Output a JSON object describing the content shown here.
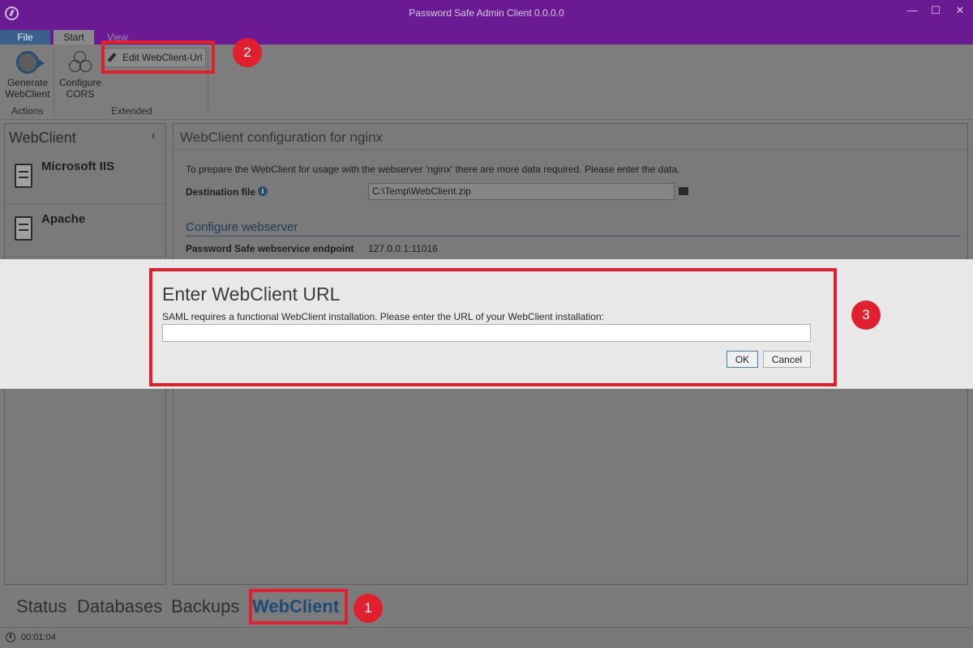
{
  "window": {
    "title": "Password Safe Admin Client 0.0.0.0",
    "controls": {
      "minimize": "—",
      "maximize": "☐",
      "close": "✕"
    }
  },
  "ribbon": {
    "tabs": [
      {
        "label": "File"
      },
      {
        "label": "Start"
      },
      {
        "label": "View"
      }
    ],
    "actions_group": {
      "label": "Actions",
      "buttons": [
        {
          "label": "Generate WebClient",
          "icon": "generate-icon"
        }
      ]
    },
    "extended_group": {
      "label": "Extended",
      "buttons": [
        {
          "label": "Configure CORS",
          "icon": "cors-icon"
        },
        {
          "label": "Edit WebClient-Url",
          "icon": "pencil-icon"
        }
      ]
    }
  },
  "sidebar": {
    "title": "WebClient",
    "collapse_glyph": "‹",
    "items": [
      {
        "label": "Microsoft IIS",
        "icon": "server-icon"
      },
      {
        "label": "Apache",
        "icon": "server-icon"
      }
    ]
  },
  "main": {
    "header": "WebClient configuration for nginx",
    "intro": "To prepare the WebClient for usage with the webserver 'nginx' there are more data required. Please enter the data.",
    "destination": {
      "label": "Destination file",
      "value": "C:\\Temp\\WebClient.zip"
    },
    "section_title": "Configure webserver",
    "endpoint": {
      "label": "Password Safe webservice endpoint",
      "value": "127.0.0.1:11016"
    }
  },
  "bottom_nav": {
    "items": [
      {
        "label": "Status"
      },
      {
        "label": "Databases"
      },
      {
        "label": "Backups"
      },
      {
        "label": "WebClient",
        "active": true
      }
    ]
  },
  "status_bar": {
    "time": "00:01:04"
  },
  "dialog": {
    "title": "Enter WebClient URL",
    "message": "SAML requires a functional WebClient installation. Please enter the URL of your WebClient installation:",
    "input_value": "",
    "ok_label": "OK",
    "cancel_label": "Cancel"
  },
  "annotations": [
    {
      "label": "1"
    },
    {
      "label": "2"
    },
    {
      "label": "3"
    }
  ],
  "colors": {
    "titlebar": "#6a1a92",
    "annotation": "#e0202f",
    "accent": "#1d4a77"
  }
}
